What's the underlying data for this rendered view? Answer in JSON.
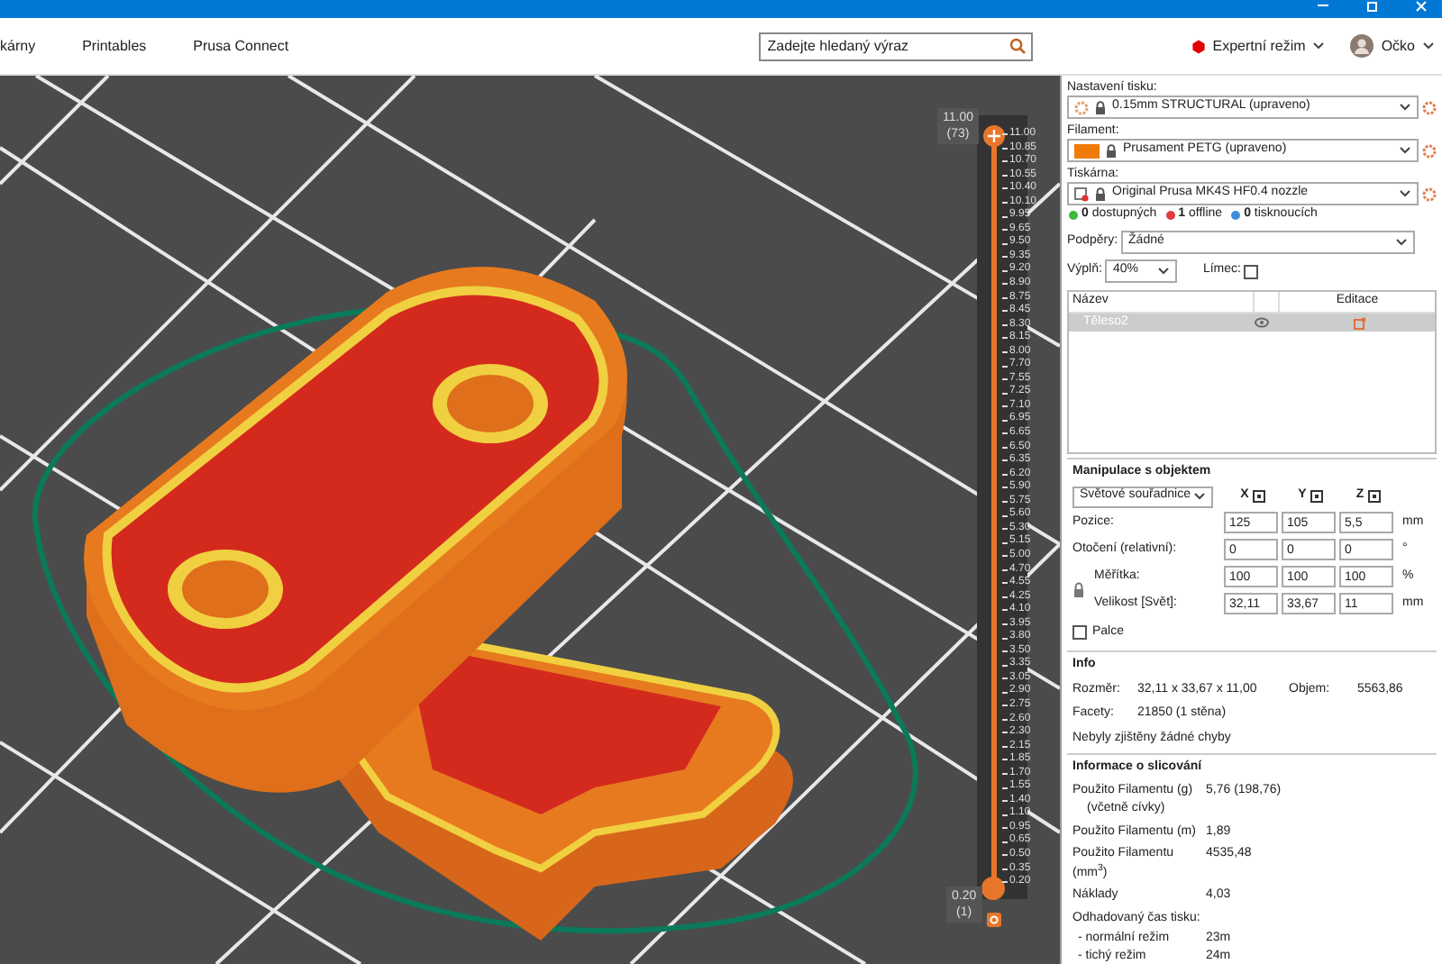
{
  "toolbar": {
    "tabs": [
      {
        "label": "kárny",
        "selected": false
      },
      {
        "label": "Printables",
        "selected": false
      },
      {
        "label": "Prusa Connect",
        "selected": false
      }
    ],
    "search": {
      "placeholder": "Zadejte hledaný výraz"
    },
    "mode": "Expertní režim",
    "user": "Očko"
  },
  "slider": {
    "top_label": "11.00",
    "top_layer": "(73)",
    "bottom_label": "0.20",
    "bottom_layer": "(1)",
    "ticks": [
      "11.00",
      "10.85",
      "10.70",
      "10.55",
      "10.40",
      "10.10",
      "9.95",
      "9.65",
      "9.50",
      "9.35",
      "9.20",
      "8.90",
      "8.75",
      "8.45",
      "8.30",
      "8.15",
      "8.00",
      "7.70",
      "7.55",
      "7.25",
      "7.10",
      "6.95",
      "6.65",
      "6.50",
      "6.35",
      "6.20",
      "5.90",
      "5.75",
      "5.60",
      "5.30",
      "5.15",
      "5.00",
      "4.70",
      "4.55",
      "4.25",
      "4.10",
      "3.95",
      "3.80",
      "3.50",
      "3.35",
      "3.05",
      "2.90",
      "2.75",
      "2.60",
      "2.30",
      "2.15",
      "1.85",
      "1.70",
      "1.55",
      "1.40",
      "1.10",
      "0.95",
      "0.65",
      "0.50",
      "0.35",
      "0.20"
    ]
  },
  "panel": {
    "print_settings": {
      "label": "Nastavení tisku:",
      "value": "0.15mm STRUCTURAL (upraveno)"
    },
    "filament": {
      "label": "Filament:",
      "value": "Prusament PETG (upraveno)",
      "color": "#f07b0b"
    },
    "printer": {
      "label": "Tiskárna:",
      "value": "Original Prusa MK4S HF0.4 nozzle"
    },
    "printer_status": [
      {
        "count": "0",
        "text": "dostupných",
        "color": "#3cb93c"
      },
      {
        "count": "1",
        "text": "offline",
        "color": "#e03c3c"
      },
      {
        "count": "0",
        "text": "tisknoucích",
        "color": "#3c8ce0"
      }
    ],
    "supports": {
      "label": "Podpěry:",
      "value": "Žádné"
    },
    "infill": {
      "label": "Výplň:",
      "value": "40%"
    },
    "brim": {
      "label": "Límec:",
      "checked": false
    },
    "objects": {
      "columns": [
        "Název",
        "Editace"
      ],
      "rows": [
        {
          "name": "Těleso2",
          "selected": true
        }
      ]
    },
    "manipulation": {
      "title": "Manipulace s objektem",
      "coordinates": "Světové souřadnice",
      "axes": [
        "X",
        "Y",
        "Z"
      ],
      "rows": [
        {
          "label": "Pozice:",
          "values": [
            "125",
            "105",
            "5,5"
          ],
          "unit": "mm"
        },
        {
          "label": "Otočení (relativní):",
          "values": [
            "0",
            "0",
            "0"
          ],
          "unit": "°"
        },
        {
          "label": "Měřítka:",
          "values": [
            "100",
            "100",
            "100"
          ],
          "unit": "%"
        },
        {
          "label": "Velikost [Svět]:",
          "values": [
            "32,11",
            "33,67",
            "11"
          ],
          "unit": "mm"
        }
      ],
      "inches": {
        "label": "Palce",
        "checked": false
      }
    },
    "info": {
      "title": "Info",
      "size_label": "Rozměr:",
      "size": "32,11 x 33,67 x 11,00",
      "volume_label": "Objem:",
      "volume": "5563,86",
      "facets_label": "Facety:",
      "facets": "21850 (1 stěna)",
      "errors": "Nebyly zjištěny žádné chyby"
    },
    "slicing": {
      "title": "Informace o slicování",
      "rows": [
        {
          "label": "Použito Filamentu (g)",
          "sub": "(včetně cívky)",
          "value": "5,76 (198,76)"
        },
        {
          "label": "Použito Filamentu (m)",
          "value": "1,89"
        },
        {
          "label": "Použito Filamentu (mm$^{3}$)",
          "value": "4535,48"
        },
        {
          "label": "Náklady",
          "value": "4,03"
        }
      ],
      "time_label": "Odhadovaný čas tisku:",
      "times": [
        {
          "label": "- normální režim",
          "value": "23m"
        },
        {
          "label": "- tichý režim",
          "value": "24m"
        }
      ]
    }
  }
}
